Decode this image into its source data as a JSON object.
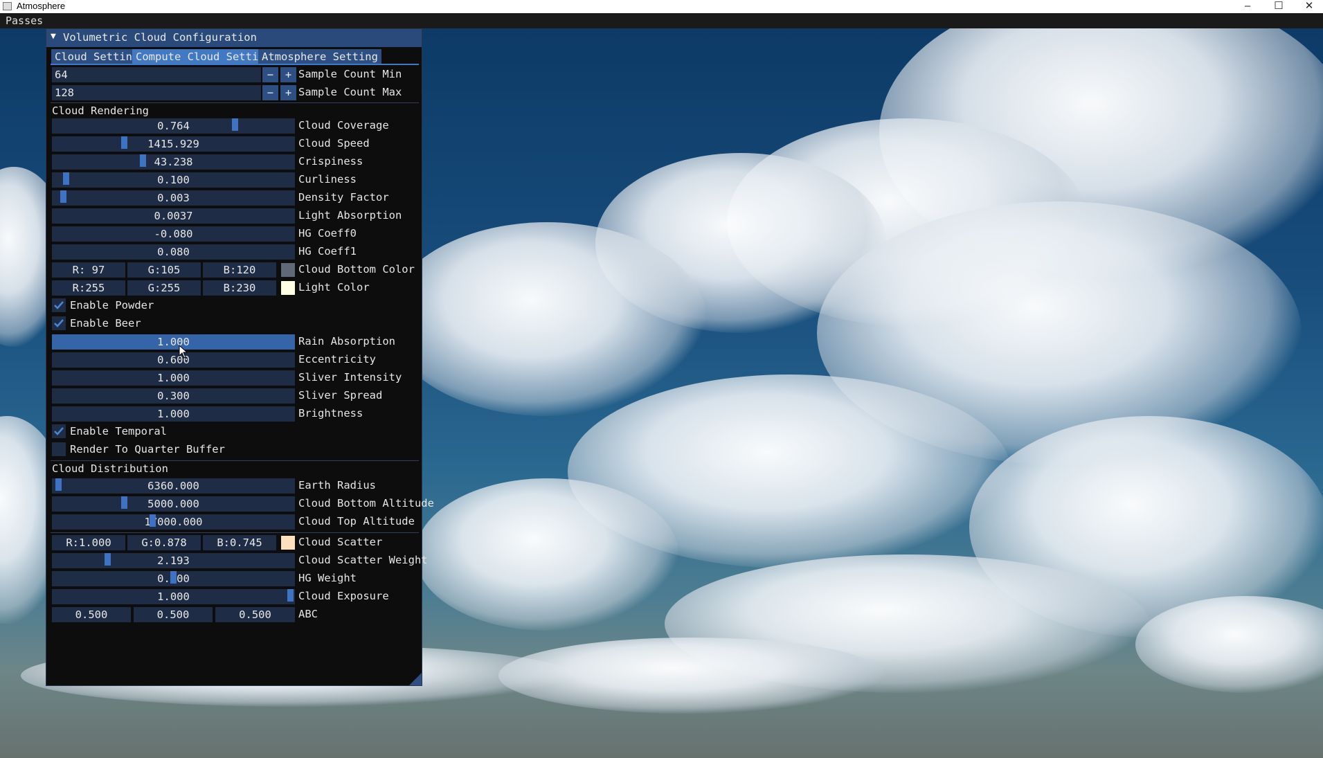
{
  "window": {
    "title": "Atmosphere",
    "minimize": "–",
    "maximize": "☐",
    "close": "✕"
  },
  "menubar": {
    "passes": "Passes"
  },
  "panel": {
    "title": "Volumetric Cloud Configuration",
    "tabs": [
      "Cloud Setting",
      "Compute Cloud Setting",
      "Atmosphere Setting"
    ],
    "active_tab": "Compute Cloud Setting",
    "sample_min": {
      "value": "64",
      "label": "Sample Count Min"
    },
    "sample_max": {
      "value": "128",
      "label": "Sample Count Max"
    },
    "stepper_minus": "−",
    "stepper_plus": "+",
    "cloud_rendering": {
      "header": "Cloud Rendering",
      "sliders": [
        {
          "value": "0.764",
          "label": "Cloud Coverage",
          "fraction": 0.764
        },
        {
          "value": "1415.929",
          "label": "Cloud Speed",
          "fraction": 0.29
        },
        {
          "value": "43.238",
          "label": "Crispiness",
          "fraction": 0.37
        },
        {
          "value": "0.100",
          "label": "Curliness",
          "fraction": 0.04
        },
        {
          "value": "0.003",
          "label": "Density Factor",
          "fraction": 0.03
        },
        {
          "value": "0.0037",
          "label": "Light Absorption",
          "fraction": null
        },
        {
          "value": "-0.080",
          "label": "HG Coeff0",
          "fraction": null
        },
        {
          "value": "0.080",
          "label": "HG Coeff1",
          "fraction": null
        }
      ],
      "bottom_color": {
        "r": "R: 97",
        "g": "G:105",
        "b": "B:120",
        "label": "Cloud Bottom Color",
        "swatch": "#616978"
      },
      "light_color": {
        "r": "R:255",
        "g": "G:255",
        "b": "B:230",
        "label": "Light Color",
        "swatch": "#ffffe6"
      },
      "enable_powder": {
        "label": "Enable Powder",
        "checked": true
      },
      "enable_beer": {
        "label": "Enable Beer",
        "checked": true
      },
      "sliders2": [
        {
          "value": "1.000",
          "label": "Rain Absorption",
          "fraction": 1.0
        },
        {
          "value": "0.600",
          "label": "Eccentricity",
          "fraction": null
        },
        {
          "value": "1.000",
          "label": "Sliver Intensity",
          "fraction": null
        },
        {
          "value": "0.300",
          "label": "Sliver Spread",
          "fraction": null
        },
        {
          "value": "1.000",
          "label": "Brightness",
          "fraction": null
        }
      ],
      "enable_temporal": {
        "label": "Enable Temporal",
        "checked": true
      },
      "quarter_buffer": {
        "label": "Render To Quarter Buffer",
        "checked": false
      }
    },
    "cloud_distribution": {
      "header": "Cloud Distribution",
      "sliders": [
        {
          "value": "6360.000",
          "label": "Earth Radius",
          "fraction": 0.01
        },
        {
          "value": "5000.000",
          "label": "Cloud Bottom Altitude",
          "fraction": 0.29
        },
        {
          "value": "17000.000",
          "label": "Cloud Top Altitude",
          "fraction": 0.41
        }
      ],
      "scatter": {
        "r": "R:1.000",
        "g": "G:0.878",
        "b": "B:0.745",
        "label": "Cloud Scatter",
        "swatch": "#ffe0be"
      },
      "sliders2": [
        {
          "value": "2.193",
          "label": "Cloud Scatter Weight",
          "fraction": 0.22
        },
        {
          "value": "0.500",
          "label": "HG Weight",
          "fraction": 0.5
        },
        {
          "value": "1.000",
          "label": "Cloud Exposure",
          "fraction": 1.0
        }
      ],
      "abc": {
        "a": "0.500",
        "b": "0.500",
        "c": "0.500",
        "label": "ABC"
      }
    }
  },
  "colors": {
    "accent": "#4279c5",
    "frame": "#1e2d45",
    "header": "#294a7a",
    "panel_bg": "#0d0d0d"
  }
}
